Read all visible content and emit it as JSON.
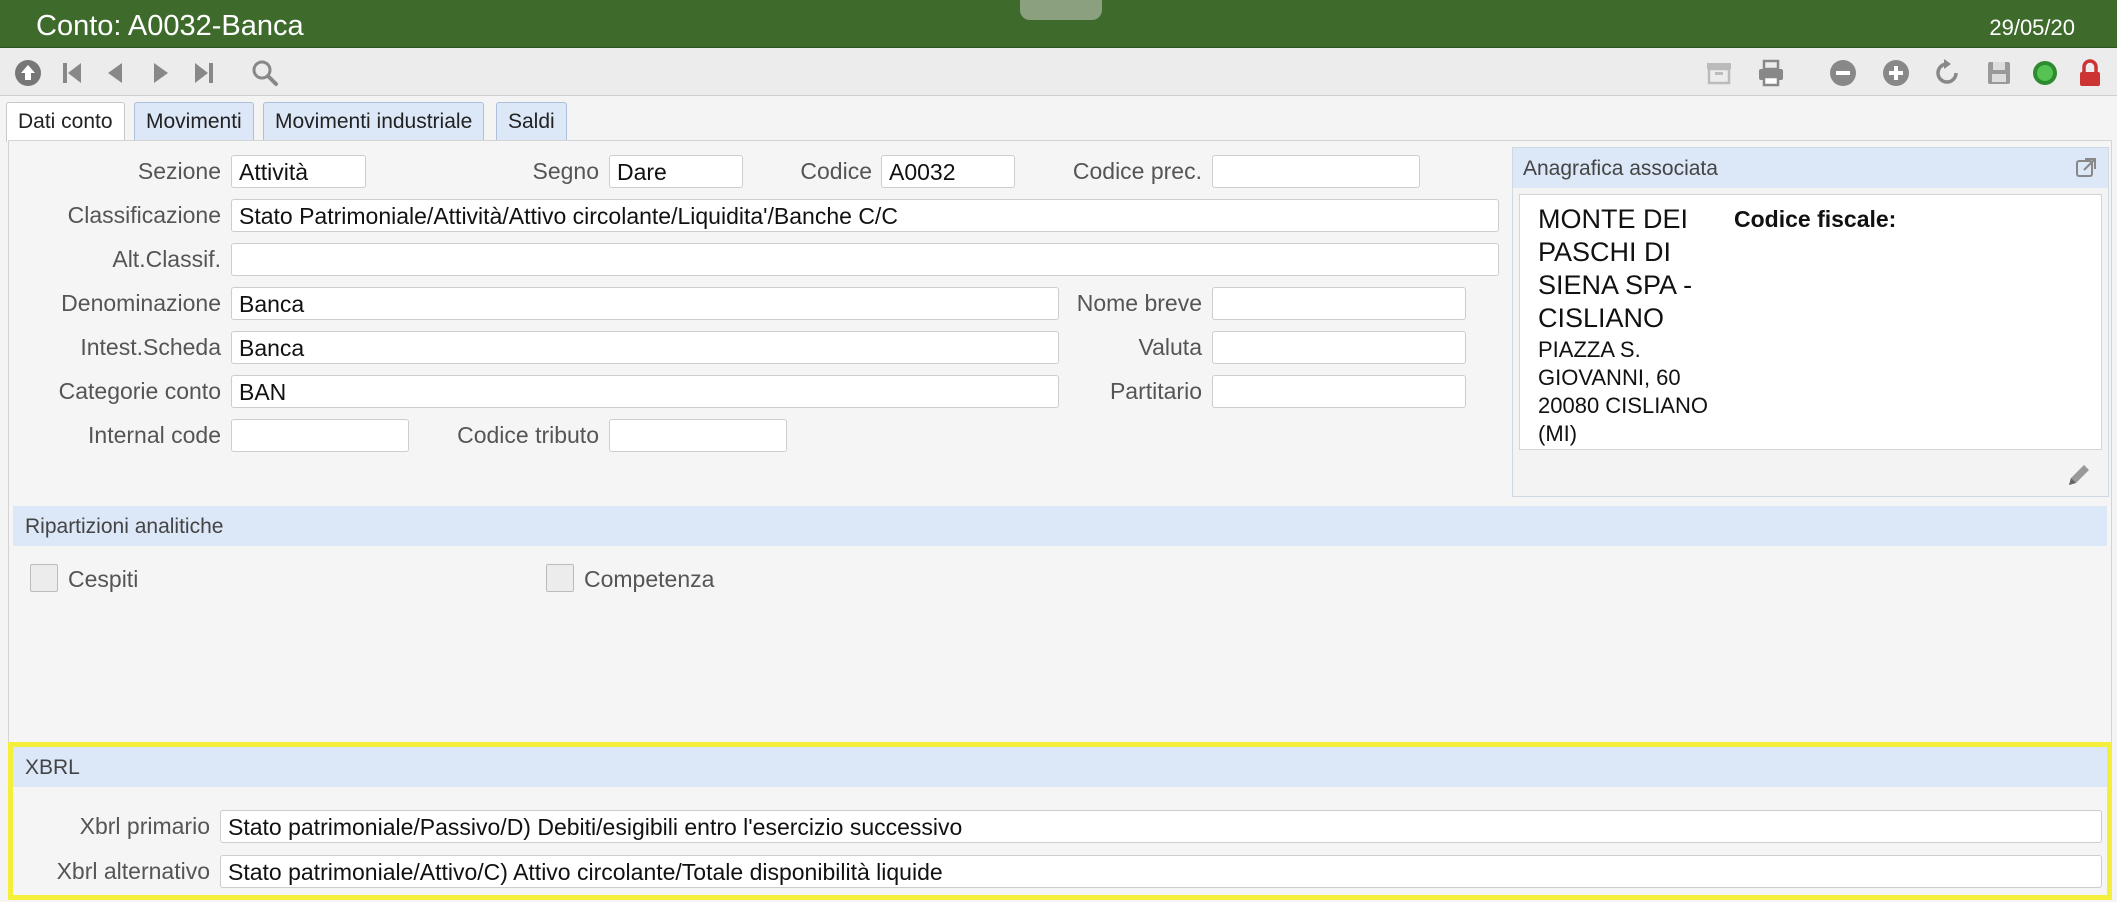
{
  "window": {
    "title": "Conto: A0032-Banca",
    "date": "29/05/20"
  },
  "toolbar_icons": [
    "up-circle-icon",
    "first-record-icon",
    "previous-icon",
    "next-icon",
    "last-record-icon",
    "search-icon",
    "archive-icon",
    "print-icon",
    "minus-circle-icon",
    "plus-circle-icon",
    "refresh-icon",
    "save-icon",
    "status-green-icon",
    "lock-icon"
  ],
  "tabs": [
    "Dati conto",
    "Movimenti",
    "Movimenti industriale",
    "Saldi"
  ],
  "form": {
    "sezione": {
      "label": "Sezione",
      "value": "Attività"
    },
    "segno": {
      "label": "Segno",
      "value": "Dare"
    },
    "codice": {
      "label": "Codice",
      "value": "A0032"
    },
    "codice_prec": {
      "label": "Codice prec.",
      "value": ""
    },
    "classificazione": {
      "label": "Classificazione",
      "value": "Stato Patrimoniale/Attività/Attivo circolante/Liquidita'/Banche C/C"
    },
    "alt_classif": {
      "label": "Alt.Classif.",
      "value": ""
    },
    "denominazione": {
      "label": "Denominazione",
      "value": "Banca"
    },
    "nome_breve": {
      "label": "Nome breve",
      "value": ""
    },
    "intest_scheda": {
      "label": "Intest.Scheda",
      "value": "Banca"
    },
    "valuta": {
      "label": "Valuta",
      "value": ""
    },
    "categorie_conto": {
      "label": "Categorie conto",
      "value": "BAN"
    },
    "partitario": {
      "label": "Partitario",
      "value": ""
    },
    "internal_code": {
      "label": "Internal code",
      "value": ""
    },
    "codice_tributo": {
      "label": "Codice tributo",
      "value": ""
    }
  },
  "anagrafica": {
    "header": "Anagrafica associata",
    "name_lines": [
      "MONTE DEI",
      "PASCHI DI",
      "SIENA SPA -",
      "CISLIANO"
    ],
    "address_lines": [
      "PIAZZA S.",
      "GIOVANNI, 60",
      "20080 CISLIANO",
      "(MI)"
    ],
    "codice_fiscale_label": "Codice fiscale:"
  },
  "ripartizioni": {
    "header": "Ripartizioni analitiche",
    "cespiti": "Cespiti",
    "competenza": "Competenza"
  },
  "xbrl": {
    "header": "XBRL",
    "primario": {
      "label": "Xbrl primario",
      "value": "Stato patrimoniale/Passivo/D) Debiti/esigibili entro l'esercizio successivo"
    },
    "alternativo": {
      "label": "Xbrl alternativo",
      "value": "Stato patrimoniale/Attivo/C) Attivo circolante/Totale disponibilità liquide"
    }
  },
  "colors": {
    "titlebar": "#3e6b2c",
    "section_header": "#dce7f7",
    "highlight": "#f4ef3a"
  }
}
